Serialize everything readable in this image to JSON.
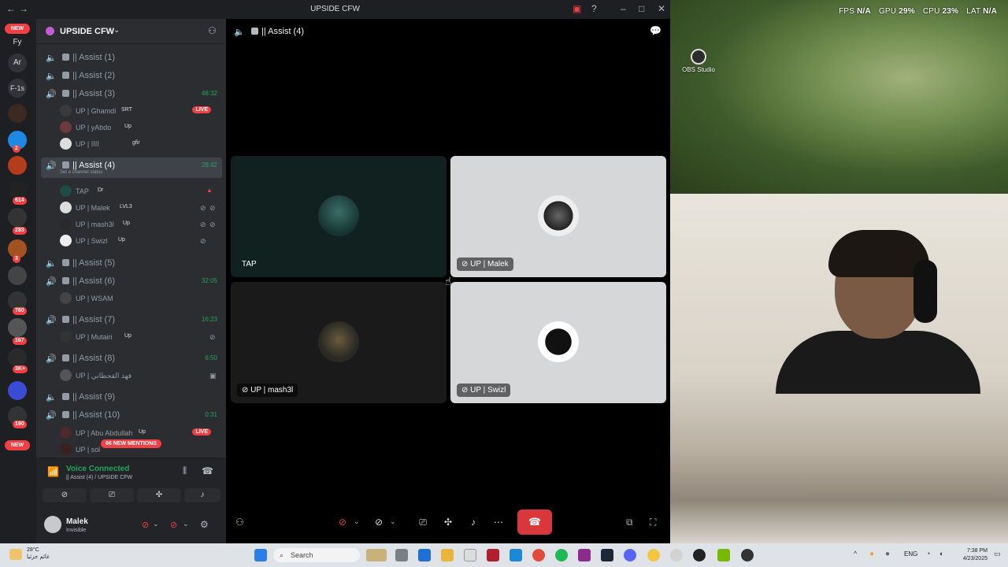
{
  "window": {
    "title": "UPSIDE CFW"
  },
  "overlay": {
    "fps_label": "FPS",
    "fps_value": "N/A",
    "gpu_label": "GPU",
    "gpu_value": "29%",
    "cpu_label": "CPU",
    "cpu_value": "23%",
    "lat_label": "LAT",
    "lat_value": "N/A"
  },
  "desktop_icon": {
    "label": "OBS Studio"
  },
  "rail": {
    "new_top": "NEW",
    "new_bottom": "NEW",
    "labels": [
      "Fy",
      "Ar",
      "F-1s"
    ],
    "badges": [
      "2",
      "614",
      "283",
      "3",
      "760",
      "167",
      "3K+",
      "190"
    ]
  },
  "server": {
    "name": "UPSIDE CFW",
    "channel_status_hint": "Set a channel status"
  },
  "channels": [
    {
      "label": "|| Assist (1)",
      "time": ""
    },
    {
      "label": "|| Assist (2)",
      "time": ""
    },
    {
      "label": "|| Assist (3)",
      "time": "46:32"
    },
    {
      "label": "|| Assist (4)",
      "time": "28:42"
    },
    {
      "label": "|| Assist (5)",
      "time": ""
    },
    {
      "label": "|| Assist (6)",
      "time": "32:05"
    },
    {
      "label": "|| Assist (7)",
      "time": "16:23"
    },
    {
      "label": "|| Assist (8)",
      "time": "6:50"
    },
    {
      "label": "|| Assist (9)",
      "time": ""
    },
    {
      "label": "|| Assist (10)",
      "time": "0:31"
    }
  ],
  "users": {
    "ch3": [
      {
        "name": "UP | Ghamdi",
        "tag": "SRT",
        "live": "LIVE"
      },
      {
        "name": "UP | yAbdo",
        "tag": "Up"
      },
      {
        "name": "UP | ﺍﺍﺍﺍ",
        "tag": "gfir"
      }
    ],
    "ch4": [
      {
        "name": "TAP",
        "tag": "Dr"
      },
      {
        "name": "UP | Malek",
        "tag": "LVL3"
      },
      {
        "name": "UP | mash3l",
        "tag": "Up"
      },
      {
        "name": "UP | Swizl",
        "tag": "Up"
      }
    ],
    "ch6": [
      {
        "name": "UP | WSAM"
      }
    ],
    "ch7": [
      {
        "name": "UP | Mutairi",
        "tag": "Up"
      }
    ],
    "ch8": [
      {
        "name": "UP | فهد القحطاني"
      }
    ],
    "ch10": [
      {
        "name": "UP | Abu Abdullah",
        "tag": "Up",
        "live": "LIVE"
      },
      {
        "name": "UP | sol"
      }
    ]
  },
  "mentions_label": "66 NEW MENTIONS",
  "voice": {
    "status": "Voice Connected",
    "location": "|| Assist (4) / UPSIDE CFW"
  },
  "me": {
    "name": "Malek",
    "status": "Invisible"
  },
  "stage": {
    "channel_title": "|| Assist (4)",
    "tiles": [
      {
        "name": "TAP"
      },
      {
        "name": "UP | Malek"
      },
      {
        "name": "UP | mash3l"
      },
      {
        "name": "UP | Swizl"
      }
    ]
  },
  "taskbar": {
    "temp": "28°C",
    "weather": "غائم جزئيا",
    "search_placeholder": "Search",
    "lang": "ENG",
    "time": "7:38 PM",
    "date": "4/23/2025"
  },
  "colors": {
    "online": "#23a55a",
    "live": "#f23f43",
    "sidebar": "#2b2d31",
    "hangup": "#da373c"
  }
}
